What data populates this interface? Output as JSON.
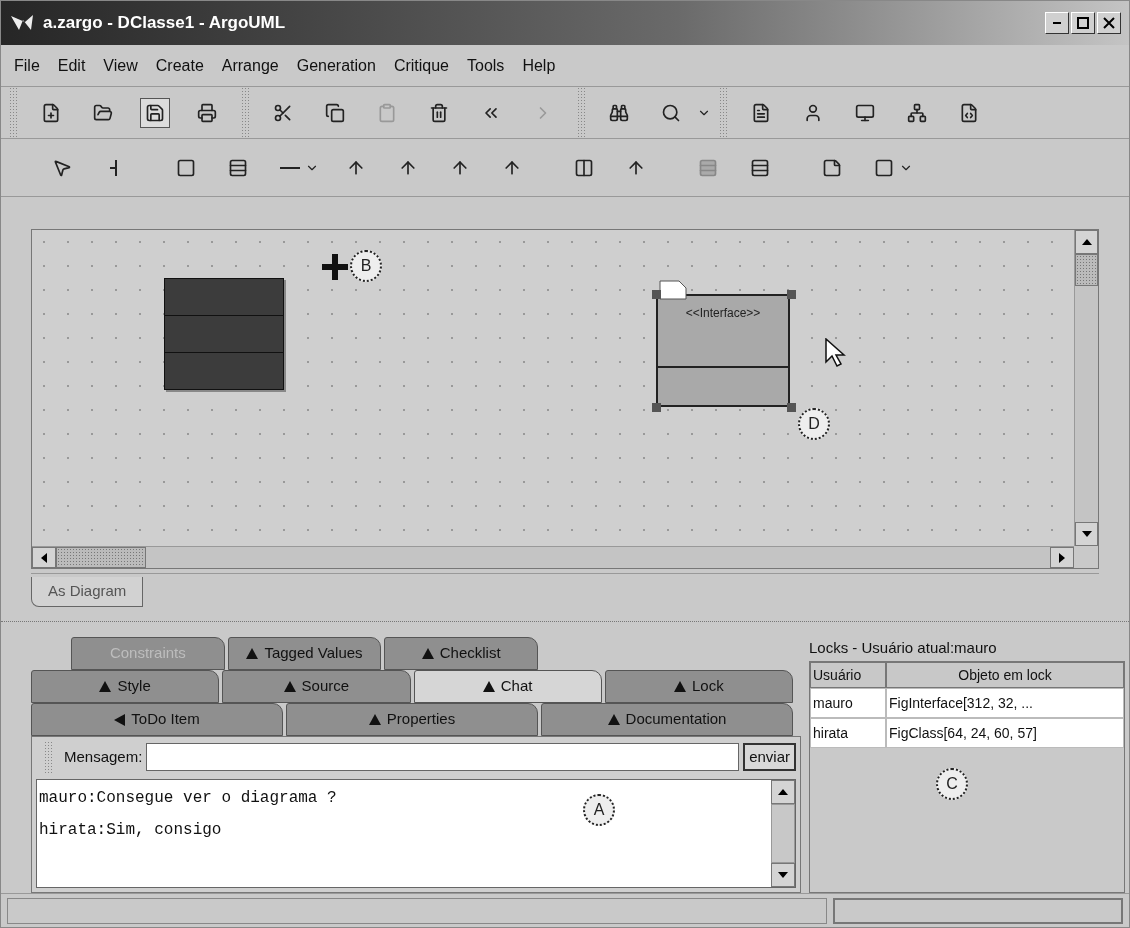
{
  "window": {
    "title": "a.zargo - DClasse1 - ArgoUML"
  },
  "menu": [
    "File",
    "Edit",
    "View",
    "Create",
    "Arrange",
    "Generation",
    "Critique",
    "Tools",
    "Help"
  ],
  "main_toolbar": [
    {
      "pressed": false,
      "disabled": false
    },
    {
      "pressed": false,
      "disabled": false
    },
    {
      "pressed": true,
      "disabled": false
    },
    {
      "pressed": false,
      "disabled": false
    },
    {
      "pressed": false,
      "disabled": false
    },
    {
      "pressed": false,
      "disabled": false
    },
    {
      "pressed": false,
      "disabled": true
    },
    {
      "pressed": false,
      "disabled": false
    },
    {
      "pressed": false,
      "disabled": false
    },
    {
      "pressed": false,
      "disabled": true
    },
    {
      "pressed": false,
      "disabled": false
    },
    {
      "pressed": false,
      "disabled": false
    },
    {
      "pressed": false,
      "disabled": false
    },
    {
      "pressed": false,
      "disabled": false
    },
    {
      "pressed": false,
      "disabled": false
    },
    {
      "pressed": false,
      "disabled": false
    },
    {
      "pressed": false,
      "disabled": false
    }
  ],
  "diagram_toolbar": [
    {
      "disabled": false
    },
    {
      "disabled": false
    },
    {
      "disabled": false
    },
    {
      "disabled": false
    },
    {
      "disabled": false
    },
    {
      "disabled": false
    },
    {
      "disabled": false
    },
    {
      "disabled": false
    },
    {
      "disabled": false
    },
    {
      "disabled": false
    },
    {
      "disabled": false
    },
    {
      "disabled": true
    },
    {
      "disabled": false
    },
    {
      "disabled": false
    },
    {
      "disabled": false
    }
  ],
  "canvas": {
    "interface_stereotype": "<<Interface>>",
    "callouts": [
      "B",
      "D"
    ]
  },
  "view_tabs": [
    {
      "label": "As Diagram",
      "selected": true
    }
  ],
  "detail_tabs": [
    [
      {
        "label": "Constraints",
        "kind": "plain",
        "selected": false,
        "disabled": true
      },
      {
        "label": "Tagged Values",
        "kind": "up",
        "selected": false,
        "disabled": false
      },
      {
        "label": "Checklist",
        "kind": "up",
        "selected": false,
        "disabled": false
      }
    ],
    [
      {
        "label": "Style",
        "kind": "up",
        "selected": false,
        "disabled": false
      },
      {
        "label": "Source",
        "kind": "up",
        "selected": false,
        "disabled": false
      },
      {
        "label": "Chat",
        "kind": "up",
        "selected": true,
        "disabled": false
      },
      {
        "label": "Lock",
        "kind": "up",
        "selected": false,
        "disabled": false
      }
    ],
    [
      {
        "label": "ToDo Item",
        "kind": "left",
        "selected": false,
        "disabled": false
      },
      {
        "label": "Properties",
        "kind": "up",
        "selected": false,
        "disabled": false
      },
      {
        "label": "Documentation",
        "kind": "up",
        "selected": false,
        "disabled": false
      }
    ]
  ],
  "chat": {
    "message_label": "Mensagem:",
    "send_button": "enviar",
    "lines": [
      "mauro:Consegue ver o diagrama ?",
      "hirata:Sim, consigo"
    ],
    "callout": "A"
  },
  "locks": {
    "title": "Locks - Usuário atual:mauro",
    "columns": [
      "Usuário",
      "Objeto em lock"
    ],
    "rows": [
      [
        "mauro",
        "FigInterface[312, 32, ..."
      ],
      [
        "hirata",
        "FigClass[64, 24, 60, 57]"
      ]
    ],
    "callout": "C"
  }
}
